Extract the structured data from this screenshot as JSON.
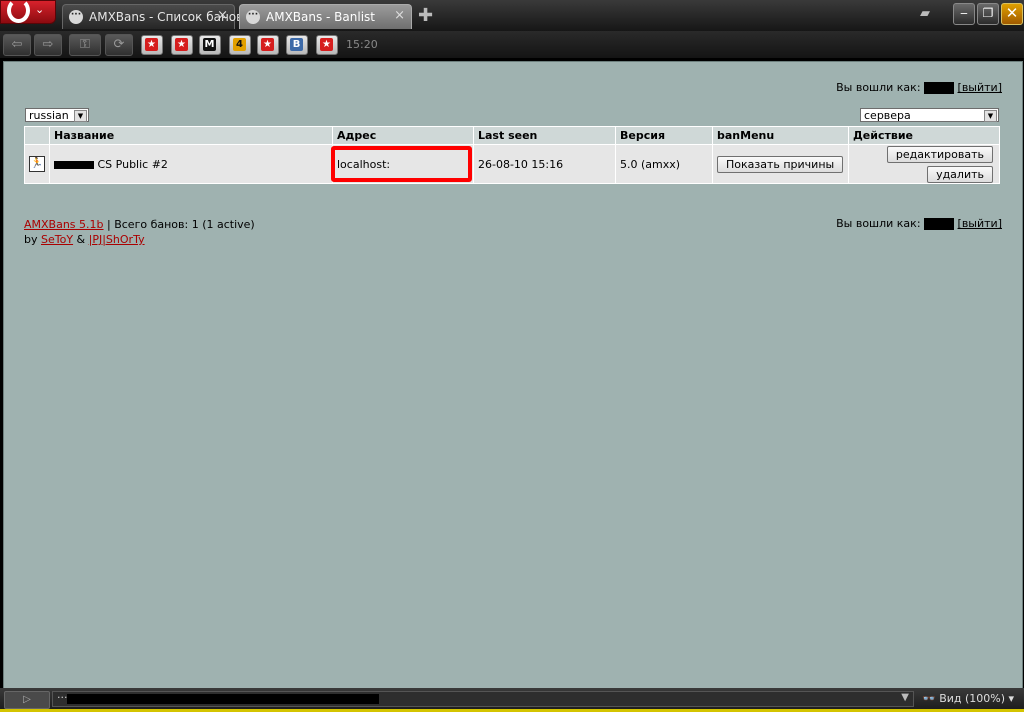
{
  "browser": {
    "tabs": [
      {
        "label": "AMXBans - Список банов",
        "active": false
      },
      {
        "label": "AMXBans - Banlist",
        "active": true
      }
    ],
    "new_tab_icon": "plus-icon",
    "clock": "15:20",
    "bookmarks": [
      "star",
      "star",
      "M",
      "4",
      "star",
      "B",
      "star"
    ],
    "status_zoom": "Вид (100%)"
  },
  "page": {
    "logged_in_label": "Вы вошли как:",
    "logout_label": "[выйти]",
    "language_select": "russian",
    "view_select": "сервера",
    "table": {
      "headers": [
        "",
        "Название",
        "Адрес",
        "Last seen",
        "Версия",
        "banMenu",
        "Действие"
      ],
      "rows": [
        {
          "name": "CS Public #2",
          "address": "localhost:",
          "last_seen": "26-08-10 15:16",
          "version": "5.0 (amxx)",
          "banmenu_button": "Показать причины",
          "edit_button": "редактировать",
          "delete_button": "удалить"
        }
      ]
    },
    "footer": {
      "product_link": "AMXBans 5.1b",
      "total_bans": " | Всего банов: 1 (1 active)",
      "by": "by ",
      "author1": "SeToY",
      "amp": " & ",
      "author2": "|PJ|ShOrTy"
    }
  },
  "colors": {
    "page_background": "#9fb2b0",
    "highlight_box": "#ff0000",
    "link": "#aa0000"
  }
}
